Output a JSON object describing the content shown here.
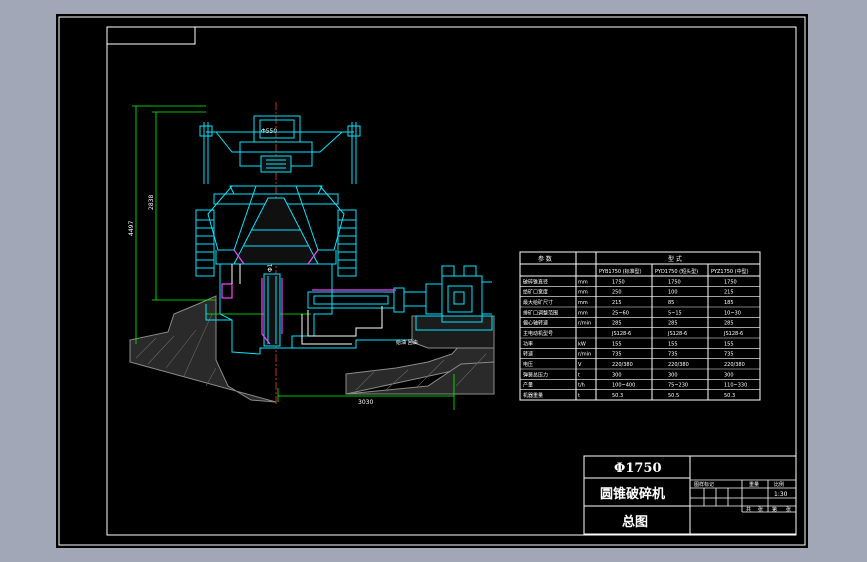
{
  "title_block": {
    "model": "Φ1750",
    "name": "圆锥破碎机",
    "sheet": "总图",
    "headers": [
      "图样标记",
      "重量",
      "比例"
    ],
    "scale": "1:30",
    "sheet_labels": [
      "共",
      "张",
      "第",
      "张"
    ]
  },
  "dimensions": {
    "overall_height": "4497",
    "column_height": "2838",
    "width": "3030",
    "top_size": "Φ550",
    "cone_size": "Φ1750"
  },
  "spec_table": {
    "header_param": "参  数",
    "header_type": "型  式",
    "models": [
      "PYB1750 (标准型)",
      "PYD1750 (短头型)",
      "PYZ1750 (中型)"
    ],
    "rows": [
      {
        "label": "破碎锥直径",
        "unit": "mm",
        "values": [
          "1750",
          "1750",
          "1750"
        ]
      },
      {
        "label": "给矿口宽度",
        "unit": "mm",
        "values": [
          "250",
          "100",
          "215"
        ]
      },
      {
        "label": "最大给矿尺寸",
        "unit": "mm",
        "values": [
          "215",
          "85",
          "185"
        ]
      },
      {
        "label": "排矿口调整范围",
        "unit": "mm",
        "values": [
          "25~60",
          "5~15",
          "10~30"
        ]
      },
      {
        "label": "偏心轴转速",
        "unit": "r/min",
        "values": [
          "285",
          "285",
          "285"
        ]
      },
      {
        "label": "主电动机型号",
        "unit": "",
        "values": [
          "JS128-6",
          "JS128-6",
          "JS128-6"
        ]
      },
      {
        "label": "功率",
        "unit": "kW",
        "values": [
          "155",
          "155",
          "155"
        ]
      },
      {
        "label": "转速",
        "unit": "r/min",
        "values": [
          "735",
          "735",
          "735"
        ]
      },
      {
        "label": "电压",
        "unit": "V",
        "values": [
          "220/380",
          "220/380",
          "220/380"
        ]
      },
      {
        "label": "弹簧总压力",
        "unit": "t",
        "values": [
          "300",
          "300",
          "300"
        ]
      },
      {
        "label": "产量",
        "unit": "t/h",
        "values": [
          "100~400",
          "75~230",
          "110~330"
        ]
      },
      {
        "label": "机器重量",
        "unit": "t",
        "values": [
          "50.3",
          "50.5",
          "50.3"
        ]
      }
    ]
  },
  "notes": {
    "oil": "给油\n回油"
  },
  "colors": {
    "sheet": "#000000",
    "frame": "#ffffff",
    "structure": "#00ffff",
    "ground": "#7f7f7f",
    "accent": "#ff00ff",
    "axis": "#ff0000",
    "dim": "#00ff00"
  }
}
